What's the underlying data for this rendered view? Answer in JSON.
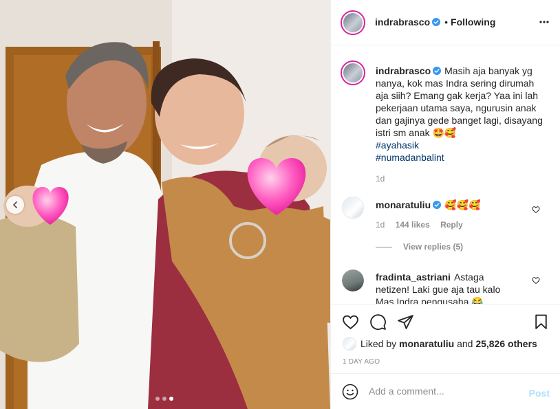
{
  "post": {
    "username": "indrabrasco",
    "follow_status": "Following",
    "caption": "Masih aja banyak yg nanya, kok mas Indra sering dirumah aja siih? Emang gak kerja? Yaa ini lah pekerjaan utama saya, ngurusin anak dan gajinya gede banget lagi, disayang istri sm anak 🤩🥰",
    "hashtags": [
      "#ayahasik",
      "#numadanbalint"
    ],
    "caption_age": "1d"
  },
  "comments": [
    {
      "username": "monaratuliu",
      "text": "🥰🥰🥰",
      "age": "1d",
      "likes": "144 likes",
      "reply_label": "Reply",
      "view_replies": "View replies (5)"
    },
    {
      "username": "fradinta_astriani",
      "text": "Astaga netizen! Laki gue aja tau kalo Mas Indra pengusaha 😂"
    }
  ],
  "engagement": {
    "liked_by_prefix": "Liked by",
    "liked_by_user": "monaratuliu",
    "and": "and",
    "others": "25,826 others",
    "date": "1 DAY AGO"
  },
  "composer": {
    "placeholder": "Add a comment...",
    "post_label": "Post"
  },
  "carousel": {
    "slide_count": 3,
    "active_slide": 3
  },
  "icons": {
    "more": "more-options-icon",
    "like": "heart-icon",
    "comment": "comment-icon",
    "share": "share-icon",
    "save": "bookmark-icon",
    "emoji": "emoji-icon",
    "prev": "chevron-left-icon"
  },
  "colors": {
    "verified": "#3897f0",
    "link": "#00376b",
    "post_disabled": "#b2dffc",
    "story_ring": "#d6249f"
  }
}
